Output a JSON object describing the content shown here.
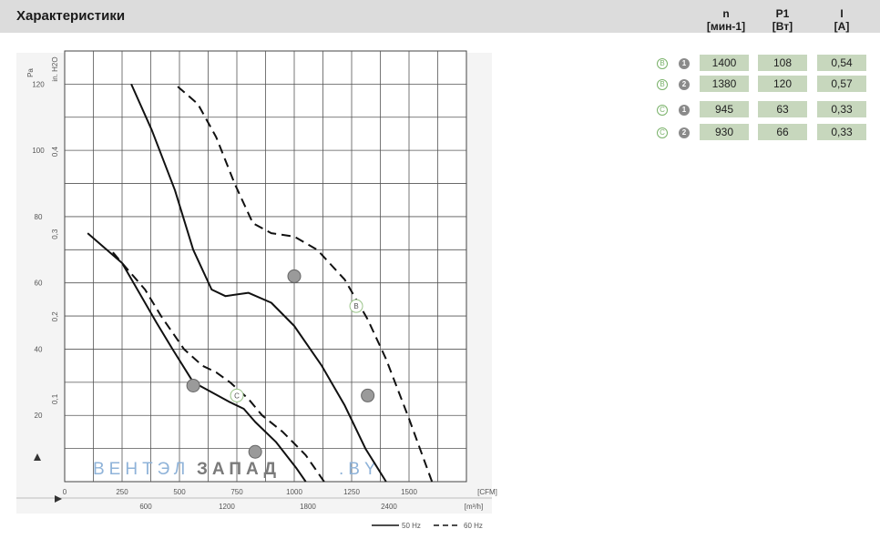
{
  "header": {
    "title": "Характеристики",
    "columns": [
      {
        "symbol": "n",
        "unit": "[мин-1]"
      },
      {
        "symbol": "P1",
        "unit": "[Вт]"
      },
      {
        "symbol": "I",
        "unit": "[A]"
      }
    ]
  },
  "spec_rows": [
    {
      "letter": "B",
      "num": "1",
      "n": "1400",
      "p": "108",
      "i": "0,54"
    },
    {
      "letter": "B",
      "num": "2",
      "n": "1380",
      "p": "120",
      "i": "0,57"
    },
    {
      "letter": "C",
      "num": "1",
      "n": "945",
      "p": "63",
      "i": "0,33"
    },
    {
      "letter": "C",
      "num": "2",
      "n": "930",
      "p": "66",
      "i": "0,33"
    }
  ],
  "chart_data": {
    "type": "line",
    "y_axis": {
      "label": "Pa",
      "ticks": [
        "20",
        "40",
        "60",
        "80",
        "100",
        "120"
      ],
      "range": [
        0,
        130
      ]
    },
    "y_axis_secondary": {
      "label": "in. H2O",
      "ticks": [
        "0,1",
        "0,2",
        "0,3",
        "0,4"
      ]
    },
    "x_axis_cfm": {
      "label": "CFM",
      "ticks": [
        "0",
        "250",
        "500",
        "750",
        "1000",
        "1250",
        "1500"
      ],
      "range": [
        0,
        1750
      ]
    },
    "x_axis_m3h": {
      "label": "m³/h",
      "ticks": [
        "600",
        "1200",
        "1800",
        "2400"
      ]
    },
    "legend": [
      {
        "label": "50 Hz",
        "style": "solid"
      },
      {
        "label": "60 Hz",
        "style": "dashed"
      }
    ],
    "series": [
      {
        "style": "solid",
        "x": [
          1050,
          1010,
          920,
          830,
          780,
          720,
          640,
          560,
          470,
          400,
          250,
          100
        ],
        "y": [
          0,
          4,
          12,
          18,
          22,
          24,
          27,
          30,
          40,
          48,
          66,
          75
        ]
      },
      {
        "style": "dashed",
        "x": [
          1130,
          1050,
          950,
          860,
          800,
          720,
          660,
          600,
          520,
          420,
          350,
          250,
          200
        ],
        "y": [
          0,
          8,
          15,
          20,
          25,
          30,
          33,
          35,
          40,
          50,
          58,
          66,
          70
        ]
      },
      {
        "style": "solid",
        "x": [
          1400,
          1310,
          1220,
          1120,
          1000,
          900,
          800,
          700,
          640,
          560,
          480,
          380,
          290
        ],
        "y": [
          0,
          10,
          23,
          35,
          47,
          54,
          57,
          56,
          58,
          70,
          88,
          106,
          120
        ]
      },
      {
        "style": "dashed",
        "x": [
          1600,
          1500,
          1400,
          1320,
          1220,
          1100,
          1000,
          900,
          820,
          740,
          660,
          580,
          480
        ],
        "y": [
          0,
          19,
          37,
          49,
          61,
          70,
          74,
          75,
          78,
          90,
          104,
          114,
          120
        ]
      }
    ],
    "operating_points": [
      {
        "x": 560,
        "y": 29
      },
      {
        "x": 830,
        "y": 9
      },
      {
        "x": 1000,
        "y": 62
      },
      {
        "x": 1320,
        "y": 26
      }
    ],
    "curve_labels": [
      {
        "x": 750,
        "y": 26,
        "letter": "C"
      },
      {
        "x": 1270,
        "y": 53,
        "letter": "B"
      }
    ]
  },
  "watermark": {
    "part1": "ВЕНТЭЛ",
    "part2": "ЗАПАД",
    "part3": ".BY"
  }
}
